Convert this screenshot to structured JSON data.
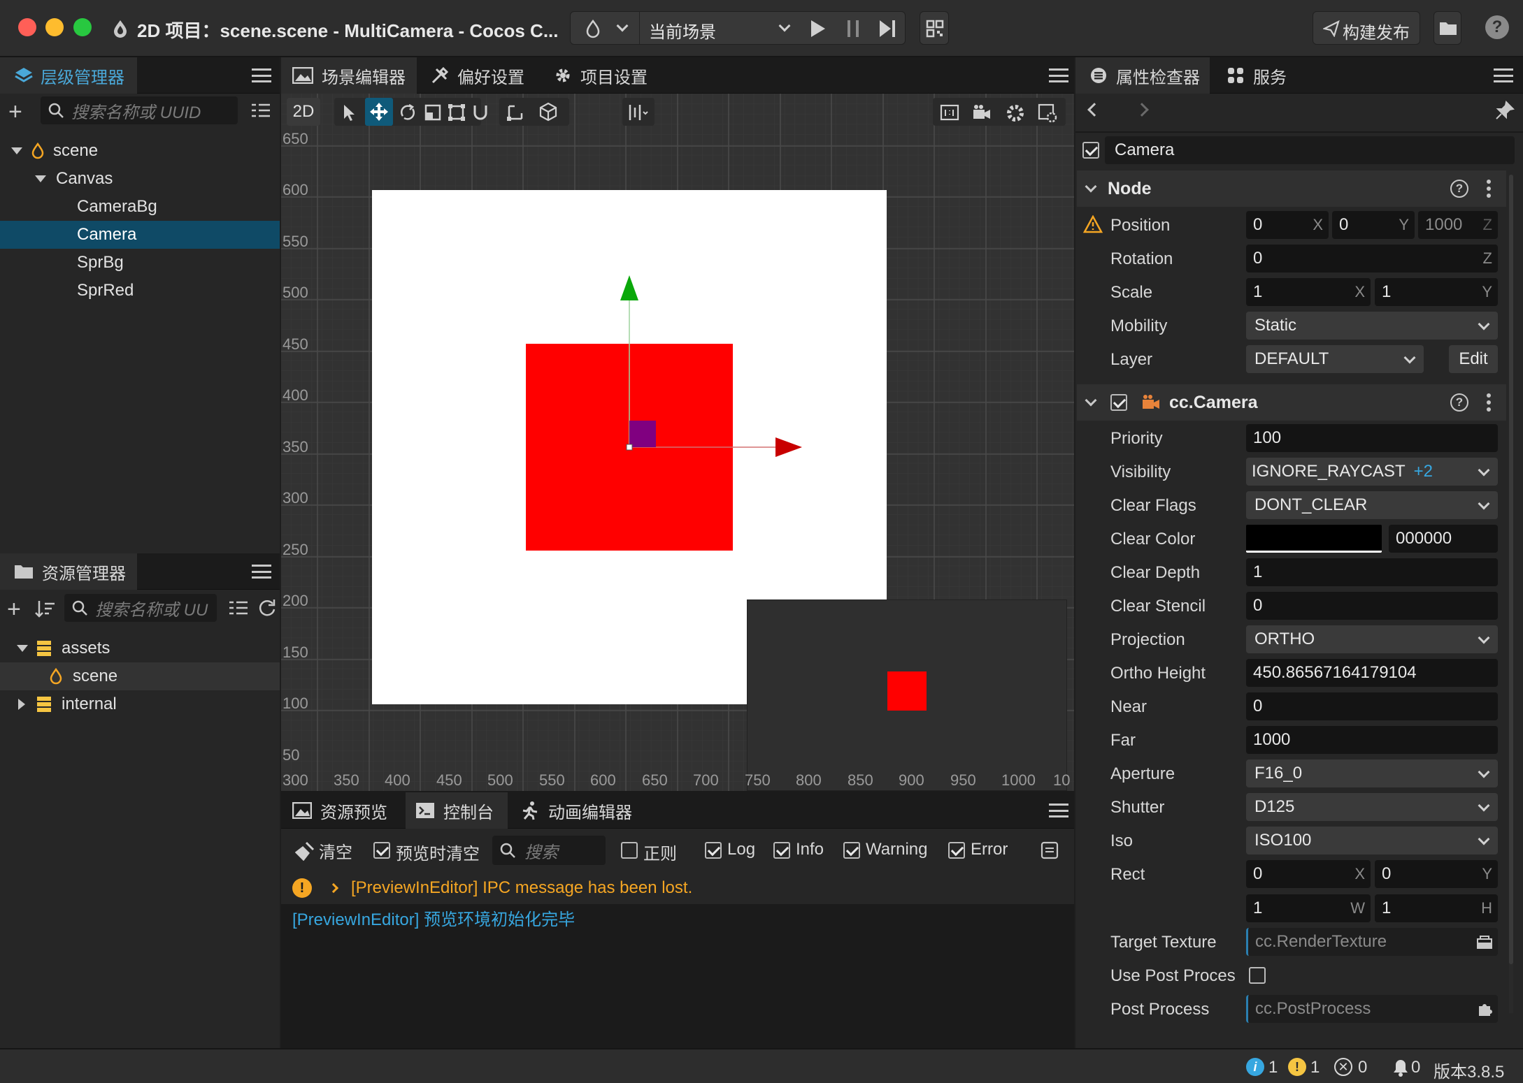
{
  "window": {
    "title": "2D 项目：scene.scene - MultiCamera - Cocos C...",
    "scene_select": "当前场景",
    "build_button": "构建发布"
  },
  "hierarchy": {
    "tab": "层级管理器",
    "search_placeholder": "搜索名称或 UUID",
    "items": [
      {
        "label": "scene"
      },
      {
        "label": "Canvas"
      },
      {
        "label": "CameraBg"
      },
      {
        "label": "Camera"
      },
      {
        "label": "SprBg"
      },
      {
        "label": "SprRed"
      }
    ],
    "selected": "Camera"
  },
  "assets": {
    "tab": "资源管理器",
    "search_placeholder": "搜索名称或 UU",
    "items": [
      {
        "label": "assets"
      },
      {
        "label": "scene"
      },
      {
        "label": "internal"
      }
    ]
  },
  "scene_editor": {
    "tabs": [
      {
        "label": "场景编辑器"
      },
      {
        "label": "偏好设置"
      },
      {
        "label": "项目设置"
      }
    ],
    "mode_2d": "2D",
    "y_ruler": [
      "650",
      "600",
      "550",
      "500",
      "450",
      "400",
      "350",
      "300",
      "250",
      "200",
      "150",
      "100",
      "50"
    ],
    "x_ruler": [
      "300",
      "350",
      "400",
      "450",
      "500",
      "550",
      "600",
      "650",
      "700",
      "750",
      "800",
      "850",
      "900",
      "950",
      "1000",
      "10"
    ],
    "colors": {
      "background": "#333333",
      "canvas": "#ffffff",
      "red": "#ff0000",
      "purple": "#800080",
      "gizmo_y": "#00b400",
      "gizmo_x": "#d40000"
    }
  },
  "console": {
    "tabs": [
      {
        "label": "资源预览"
      },
      {
        "label": "控制台"
      },
      {
        "label": "动画编辑器"
      }
    ],
    "clear": "清空",
    "clear_on_preview": "预览时清空",
    "search_placeholder": "搜索",
    "regex": "正则",
    "filters": {
      "log": "Log",
      "info": "Info",
      "warning": "Warning",
      "error": "Error"
    },
    "messages": [
      {
        "text": "[PreviewInEditor] IPC message has been lost.",
        "type": "warning"
      },
      {
        "text": "[PreviewInEditor] 预览环境初始化完毕",
        "type": "info"
      }
    ]
  },
  "inspector": {
    "tabs": [
      {
        "label": "属性检查器"
      },
      {
        "label": "服务"
      }
    ],
    "node_name": "Camera",
    "node_section": "Node",
    "position_label": "Position",
    "position": {
      "x": "0",
      "y": "0",
      "z": "1000"
    },
    "rotation_label": "Rotation",
    "rotation": {
      "z": "0"
    },
    "scale_label": "Scale",
    "scale": {
      "x": "1",
      "y": "1"
    },
    "mobility_label": "Mobility",
    "mobility": "Static",
    "layer_label": "Layer",
    "layer": "DEFAULT",
    "layer_edit": "Edit",
    "component": "cc.Camera",
    "priority_label": "Priority",
    "priority": "100",
    "visibility_label": "Visibility",
    "visibility": "IGNORE_RAYCAST",
    "visibility_extra": "+2",
    "clear_flags_label": "Clear Flags",
    "clear_flags": "DONT_CLEAR",
    "clear_color_label": "Clear Color",
    "clear_color": "000000",
    "clear_depth_label": "Clear Depth",
    "clear_depth": "1",
    "clear_stencil_label": "Clear Stencil",
    "clear_stencil": "0",
    "projection_label": "Projection",
    "projection": "ORTHO",
    "ortho_height_label": "Ortho Height",
    "ortho_height": "450.86567164179104",
    "near_label": "Near",
    "near": "0",
    "far_label": "Far",
    "far": "1000",
    "aperture_label": "Aperture",
    "aperture": "F16_0",
    "shutter_label": "Shutter",
    "shutter": "D125",
    "iso_label": "Iso",
    "iso": "ISO100",
    "rect_label": "Rect",
    "rect": {
      "x": "0",
      "y": "0",
      "w": "1",
      "h": "1"
    },
    "target_texture_label": "Target Texture",
    "target_texture": "cc.RenderTexture",
    "use_post_label": "Use Post Proces",
    "post_process_label": "Post Process",
    "post_process": "cc.PostProcess"
  },
  "statusbar": {
    "info_count": "1",
    "warning_count": "1",
    "error_count": "0",
    "notify_count": "0",
    "version": "版本3.8.5"
  }
}
